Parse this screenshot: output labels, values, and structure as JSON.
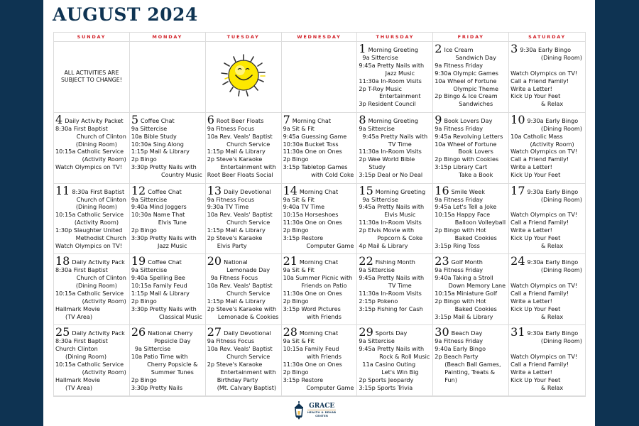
{
  "calendar": {
    "title": "AUGUST 2024",
    "days_of_week": [
      "SUNDAY",
      "MONDAY",
      "TUESDAY",
      "WEDNESDAY",
      "THURSDAY",
      "FRIDAY",
      "SATURDAY"
    ],
    "notice": [
      "ALL ACTIVITIES ARE",
      "SUBJECT TO CHANGE!"
    ],
    "decoration": "smiling-sun",
    "colors": {
      "navy": "#0e3352",
      "weekday_red": "#d2232a"
    },
    "days": [
      {
        "day": "1",
        "headline": "Morning Greeting",
        "lines": [
          {
            "t": "9a Sittercise",
            "s": "indent-left"
          },
          {
            "t": "9:45a Pretty Nails with"
          },
          {
            "t": "Jazz Music",
            "s": "indent"
          },
          {
            "t": "11:30a In-Room Visits"
          },
          {
            "t": "2p T-Roy Music"
          },
          {
            "t": "Entertainment",
            "s": "indent"
          },
          {
            "t": "3p Resident Council"
          }
        ]
      },
      {
        "day": "2",
        "headline": "Ice Cream",
        "lines": [
          {
            "t": "Sandwich Day",
            "s": "indent"
          },
          {
            "t": "9a Fitness Friday"
          },
          {
            "t": "9:30a Olympic Games"
          },
          {
            "t": "10a Wheel of Fortune"
          },
          {
            "t": "Olympic Theme",
            "s": "indent"
          },
          {
            "t": "2p Bingo & Ice Cream"
          },
          {
            "t": "Sandwiches",
            "s": "indent"
          }
        ]
      },
      {
        "day": "3",
        "headline": "9:30a Early Bingo",
        "lines": [
          {
            "t": "(Dining Room)",
            "s": "right"
          },
          {
            "t": "",
            "s": "gap"
          },
          {
            "t": "Watch Olympics on TV!"
          },
          {
            "t": "Call a Friend Family!"
          },
          {
            "t": "Write a Letter!"
          },
          {
            "t": "Kick Up Your Feet"
          },
          {
            "t": "& Relax",
            "s": "indent"
          }
        ]
      },
      {
        "day": "4",
        "headline": "Daily Activity Packet",
        "lines": [
          {
            "t": "8:30a First Baptist"
          },
          {
            "t": "Church of Clinton",
            "s": "right"
          },
          {
            "t": "(Dining Room)",
            "s": "indent"
          },
          {
            "t": "10:15a Catholic Service"
          },
          {
            "t": "(Activity Room)",
            "s": "right"
          },
          {
            "t": "Watch Olympics on TV!"
          }
        ]
      },
      {
        "day": "5",
        "headline": "Coffee Chat",
        "lines": [
          {
            "t": "9a Sittercise"
          },
          {
            "t": "10a Bible Study"
          },
          {
            "t": "10:30a Sing Along"
          },
          {
            "t": "1:15p Mail & Library"
          },
          {
            "t": "2p Bingo"
          },
          {
            "t": "3:30p Pretty Nails with"
          },
          {
            "t": "Country Music",
            "s": "right"
          }
        ]
      },
      {
        "day": "6",
        "headline": "Root Beer Floats",
        "lines": [
          {
            "t": "9a Fitness Focus"
          },
          {
            "t": "10a Rev. Veals' Baptist"
          },
          {
            "t": "Church Service",
            "s": "indent"
          },
          {
            "t": "1:15p Mail & Library"
          },
          {
            "t": "2p Steve's Karaoke"
          },
          {
            "t": "Entertainment with",
            "s": "indent"
          },
          {
            "t": "Root Beer Floats Social"
          }
        ]
      },
      {
        "day": "7",
        "headline": "Morning Chat",
        "lines": [
          {
            "t": "9a Sit & Fit"
          },
          {
            "t": "9:45a Guessing Game"
          },
          {
            "t": "10:30a Bucket Toss"
          },
          {
            "t": "11:30a One on Ones"
          },
          {
            "t": "2p Bingo"
          },
          {
            "t": "3:15p Tabletop Games"
          },
          {
            "t": "with Cold Coke",
            "s": "right"
          }
        ]
      },
      {
        "day": "8",
        "headline": "Morning Greeting",
        "lines": [
          {
            "t": "9a Sittercise"
          },
          {
            "t": "9:45a Pretty Nails with",
            "s": "indent-left"
          },
          {
            "t": "TV Time",
            "s": "indent"
          },
          {
            "t": "11:30a In-Room Visits"
          },
          {
            "t": "2p Wee World Bible"
          },
          {
            "t": "Study",
            "s": "indent-left2"
          },
          {
            "t": "3:15p Deal or No Deal"
          }
        ]
      },
      {
        "day": "9",
        "headline": "Book Lovers Day",
        "lines": [
          {
            "t": "9a Fitness Friday"
          },
          {
            "t": "9:45a Revolving Letters"
          },
          {
            "t": "10a Wheel of Fortune"
          },
          {
            "t": "Book Lovers",
            "s": "indent"
          },
          {
            "t": "2p Bingo with Cookies"
          },
          {
            "t": "3:15p Library Cart"
          },
          {
            "t": "Take a Book",
            "s": "indent"
          }
        ]
      },
      {
        "day": "10",
        "headline": "9:30a Early Bingo",
        "lines": [
          {
            "t": "(Dining Room)",
            "s": "right"
          },
          {
            "t": "10a Catholic Mass"
          },
          {
            "t": "(Activity Room)",
            "s": "indent"
          },
          {
            "t": "Watch Olympics on TV!"
          },
          {
            "t": "Call a Friend Family!"
          },
          {
            "t": "Write a Letter!"
          },
          {
            "t": "Kick Up Your Feet"
          }
        ]
      },
      {
        "day": "11",
        "headline": "8:30a First Baptist",
        "lines": [
          {
            "t": "Church of Clinton",
            "s": "right"
          },
          {
            "t": "(Dining Room)",
            "s": "indent"
          },
          {
            "t": "10:15a Catholic Service"
          },
          {
            "t": "(Activity Room)",
            "s": "indent"
          },
          {
            "t": "1:30p Slaughter United"
          },
          {
            "t": "Methodist Church",
            "s": "right"
          },
          {
            "t": "Watch Olympics on TV!"
          }
        ]
      },
      {
        "day": "12",
        "headline": "Coffee Chat",
        "lines": [
          {
            "t": "9a Sittercise"
          },
          {
            "t": "9:40a Mind Joggers"
          },
          {
            "t": "10:30a Name That"
          },
          {
            "t": "Elvis Tune",
            "s": "indent"
          },
          {
            "t": "2p Bingo"
          },
          {
            "t": "3:30p Pretty Nails with"
          },
          {
            "t": "Jazz Music",
            "s": "indent"
          }
        ]
      },
      {
        "day": "13",
        "headline": "Daily Devotional",
        "lines": [
          {
            "t": "9a Fitness Focus"
          },
          {
            "t": "9:30a TV Time"
          },
          {
            "t": "10a Rev. Veals' Baptist"
          },
          {
            "t": "Church Service",
            "s": "indent"
          },
          {
            "t": "1:15p Mail & Library"
          },
          {
            "t": "2p Steve's Karaoke"
          },
          {
            "t": "Elvis Party",
            "s": "indent-left2"
          }
        ]
      },
      {
        "day": "14",
        "headline": "Morning Chat",
        "lines": [
          {
            "t": "9a Sit & Fit"
          },
          {
            "t": "9:40a TV Time"
          },
          {
            "t": "10:15a Horseshoes"
          },
          {
            "t": "11:30a One on Ones"
          },
          {
            "t": "2p Bingo"
          },
          {
            "t": "3:15p Restore"
          },
          {
            "t": "Computer Game",
            "s": "right"
          }
        ]
      },
      {
        "day": "15",
        "headline": "Morning Greeting",
        "lines": [
          {
            "t": "9a Sittercise",
            "s": "indent-left"
          },
          {
            "t": "9:45a Pretty Nails with"
          },
          {
            "t": "Elvis Music",
            "s": "indent"
          },
          {
            "t": "11:30a In-Room Visits"
          },
          {
            "t": "2p Elvis Movie with"
          },
          {
            "t": "Popcorn & Coke",
            "s": "indent"
          },
          {
            "t": "4p Mail & Library"
          }
        ]
      },
      {
        "day": "16",
        "headline": "Smile Week",
        "lines": [
          {
            "t": "9a Fitness Friday"
          },
          {
            "t": "9:45a Let's Tell a Joke"
          },
          {
            "t": "10:15a Happy Face"
          },
          {
            "t": "Balloon Volleyball",
            "s": "right"
          },
          {
            "t": "2p Bingo with Hot"
          },
          {
            "t": "Baked Cookies",
            "s": "indent"
          },
          {
            "t": "3:15p Ring Toss"
          }
        ]
      },
      {
        "day": "17",
        "headline": "9:30a Early Bingo",
        "lines": [
          {
            "t": "(Dining Room)",
            "s": "right"
          },
          {
            "t": "",
            "s": "gap"
          },
          {
            "t": "Watch Olympics on TV!"
          },
          {
            "t": "Call a Friend Family!"
          },
          {
            "t": "Write a Letter!"
          },
          {
            "t": "Kick Up Your Feet"
          },
          {
            "t": "& Relax",
            "s": "indent"
          }
        ]
      },
      {
        "day": "18",
        "headline": "Daily Activity Pack",
        "lines": [
          {
            "t": "8:30a First Baptist"
          },
          {
            "t": "Church of Clinton",
            "s": "right"
          },
          {
            "t": "(Dining Room)",
            "s": "indent"
          },
          {
            "t": "10:15a Catholic Service"
          },
          {
            "t": "(Activity Room)",
            "s": "right"
          },
          {
            "t": "Hallmark Movie"
          },
          {
            "t": "(TV Area)",
            "s": "indent-left2"
          }
        ]
      },
      {
        "day": "19",
        "headline": "Coffee Chat",
        "lines": [
          {
            "t": "9a Sittercise"
          },
          {
            "t": "9:40a Spelling Bee"
          },
          {
            "t": "10:15a Family Feud"
          },
          {
            "t": "1:15p Mail & Library"
          },
          {
            "t": "2p Bingo"
          },
          {
            "t": "3:30p Pretty Nails with"
          },
          {
            "t": "Classical Music",
            "s": "right"
          }
        ]
      },
      {
        "day": "20",
        "headline": "National",
        "lines": [
          {
            "t": "Lemonade Day",
            "s": "indent"
          },
          {
            "t": "9a Fitness Focus",
            "s": "indent-left"
          },
          {
            "t": "10a Rev. Veals' Baptist"
          },
          {
            "t": "Church Service",
            "s": "indent"
          },
          {
            "t": "1:15p Mail & Library"
          },
          {
            "t": "2p Steve's Karaoke with"
          },
          {
            "t": "Lemonade & Cookies",
            "s": "indent"
          }
        ]
      },
      {
        "day": "21",
        "headline": "Morning Chat",
        "lines": [
          {
            "t": "9a Sit & Fit"
          },
          {
            "t": "10a Summer Picnic with"
          },
          {
            "t": "Friends on Patio",
            "s": "indent"
          },
          {
            "t": "11:30a One on Ones"
          },
          {
            "t": "2p Bingo"
          },
          {
            "t": "3:15p Word Pictures"
          },
          {
            "t": "with Friends",
            "s": "indent"
          }
        ]
      },
      {
        "day": "22",
        "headline": "Fishing Month",
        "lines": [
          {
            "t": "9a Sittercise"
          },
          {
            "t": "9:45a Pretty Nails with"
          },
          {
            "t": "TV Time",
            "s": "indent"
          },
          {
            "t": "11:30a In-Room Visits"
          },
          {
            "t": "2:15p Pokeno"
          },
          {
            "t": "3:15p Fishing for Cash"
          }
        ]
      },
      {
        "day": "23",
        "headline": "Golf Month",
        "lines": [
          {
            "t": "9a Fitness Friday"
          },
          {
            "t": "9:40a Taking a Stroll"
          },
          {
            "t": "Down Memory Lane",
            "s": "right"
          },
          {
            "t": "10:15a Miniature Golf"
          },
          {
            "t": "2p Bingo with Hot"
          },
          {
            "t": "Baked Cookies",
            "s": "indent"
          },
          {
            "t": "3:15p Mail & Library"
          }
        ]
      },
      {
        "day": "24",
        "headline": "9:30a Early Bingo",
        "lines": [
          {
            "t": "(Dining Room)",
            "s": "right"
          },
          {
            "t": "",
            "s": "gap"
          },
          {
            "t": "Watch Olympics on TV!"
          },
          {
            "t": "Call a Friend Family!"
          },
          {
            "t": "Write a Letter!"
          },
          {
            "t": "Kick Up Your Feet"
          },
          {
            "t": "& Relax",
            "s": "indent"
          }
        ]
      },
      {
        "day": "25",
        "headline": "Daily Activity Pack",
        "lines": [
          {
            "t": "8:30a First Baptist"
          },
          {
            "t": "Church Clinton"
          },
          {
            "t": "(Dining Room)",
            "s": "indent-left2"
          },
          {
            "t": "10:15a Catholic Service"
          },
          {
            "t": "(Activity Room)",
            "s": "right"
          },
          {
            "t": "Hallmark Movie"
          },
          {
            "t": "(TV Area)",
            "s": "indent-left2"
          }
        ]
      },
      {
        "day": "26",
        "headline": "National Cherry",
        "lines": [
          {
            "t": "Popsicle Day",
            "s": "indent"
          },
          {
            "t": "9a Sittercise",
            "s": "indent-left"
          },
          {
            "t": "10a Patio Time with"
          },
          {
            "t": "Cherry Popsicle &",
            "s": "indent"
          },
          {
            "t": "Summer Tunes",
            "s": "indent"
          },
          {
            "t": "2p Bingo"
          },
          {
            "t": "3:30p Pretty Nails"
          }
        ]
      },
      {
        "day": "27",
        "headline": "Daily Devotional",
        "lines": [
          {
            "t": "9a Fitness Focus"
          },
          {
            "t": "10a Rev. Veals' Baptist"
          },
          {
            "t": "Church Service",
            "s": "indent"
          },
          {
            "t": "2p Steve's Karaoke"
          },
          {
            "t": "Entertainment with",
            "s": "indent"
          },
          {
            "t": "Birthday Party",
            "s": "indent-left2"
          },
          {
            "t": "(Mt. Calvary Baptist)",
            "s": "indent-left2"
          }
        ]
      },
      {
        "day": "28",
        "headline": "Morning Chat",
        "lines": [
          {
            "t": "9a Sit & Fit"
          },
          {
            "t": "10:15a Family Feud"
          },
          {
            "t": "with Friends",
            "s": "indent"
          },
          {
            "t": "11:30a One on Ones"
          },
          {
            "t": "2p Bingo"
          },
          {
            "t": "3:15p Restore"
          },
          {
            "t": "Computer Game",
            "s": "right"
          }
        ]
      },
      {
        "day": "29",
        "headline": "Sports Day",
        "lines": [
          {
            "t": "9a Sittercise"
          },
          {
            "t": "9:45a Pretty Nails with"
          },
          {
            "t": "Rock & Roll Music",
            "s": "right"
          },
          {
            "t": "11a Casino Outing",
            "s": "indent-left"
          },
          {
            "t": "Let's Win Big",
            "s": "indent"
          },
          {
            "t": "2p Sports Jeopardy"
          },
          {
            "t": "3:15p Sports Trivia"
          }
        ]
      },
      {
        "day": "30",
        "headline": "Beach Day",
        "lines": [
          {
            "t": "9a Fitness Friday"
          },
          {
            "t": "9:40a Early Bingo"
          },
          {
            "t": "2p Beach Party"
          },
          {
            "t": "(Beach Ball Games,",
            "s": "indent-left2"
          },
          {
            "t": "Painting, Treats &",
            "s": "indent-left2"
          },
          {
            "t": "Fun)",
            "s": "indent-left2"
          }
        ]
      },
      {
        "day": "31",
        "headline": "9:30a Early Bingo",
        "lines": [
          {
            "t": "(Dining Room)",
            "s": "right"
          },
          {
            "t": "",
            "s": "gap"
          },
          {
            "t": "Watch Olympics on TV!"
          },
          {
            "t": "Call a Friend Family!"
          },
          {
            "t": "Write a Letter!"
          },
          {
            "t": "Kick Up Your Feet"
          },
          {
            "t": "& Relax",
            "s": "indent"
          }
        ]
      }
    ]
  },
  "footer": {
    "logo_name": "GRACE",
    "logo_sub_1": "HEALTH & REHAB",
    "logo_sub_2": "CENTER"
  }
}
